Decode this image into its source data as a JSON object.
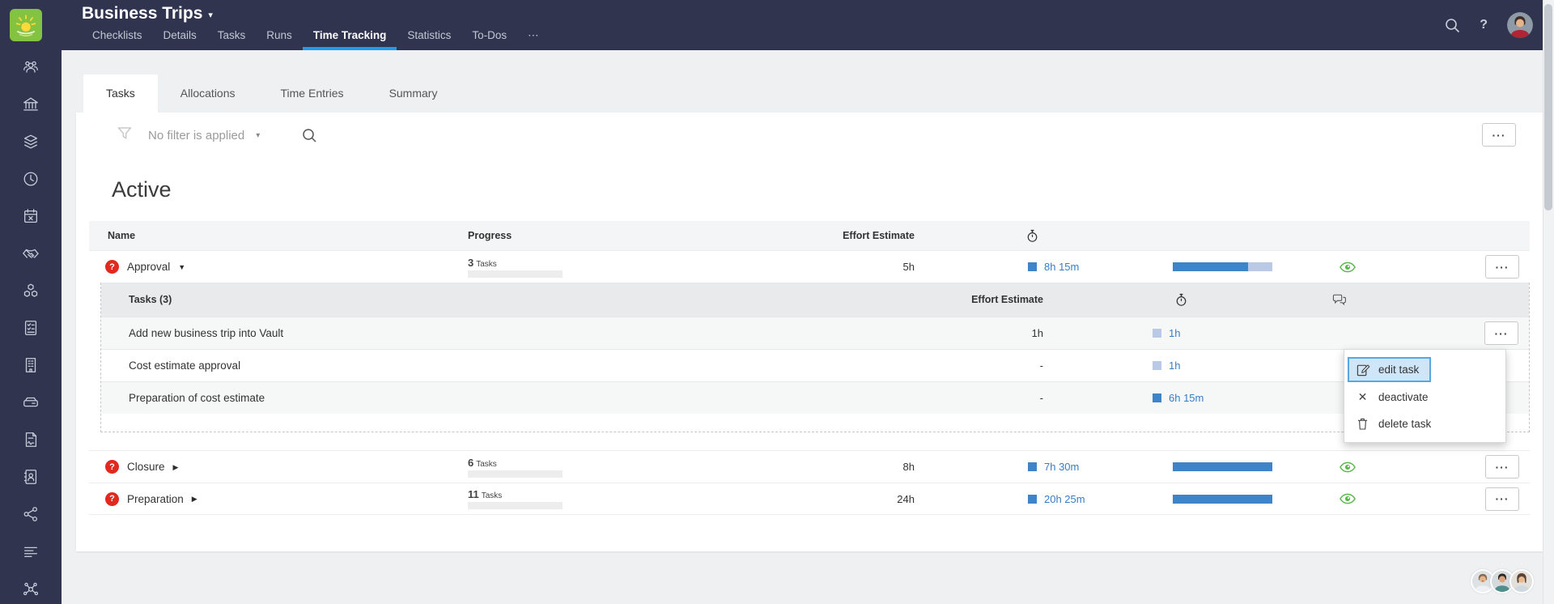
{
  "header": {
    "title": "Business Trips",
    "nav": [
      {
        "label": "Checklists"
      },
      {
        "label": "Details"
      },
      {
        "label": "Tasks"
      },
      {
        "label": "Runs"
      },
      {
        "label": "Time Tracking",
        "active": true
      },
      {
        "label": "Statistics"
      },
      {
        "label": "To-Dos"
      },
      {
        "label": "⋯"
      }
    ],
    "help_glyph": "?"
  },
  "subtabs": [
    {
      "label": "Tasks",
      "active": true
    },
    {
      "label": "Allocations"
    },
    {
      "label": "Time Entries"
    },
    {
      "label": "Summary"
    }
  ],
  "filter": {
    "label": "No filter is applied",
    "caret": "▾"
  },
  "section_title": "Active",
  "table": {
    "headers": {
      "name": "Name",
      "progress": "Progress",
      "effort": "Effort Estimate"
    },
    "rows": [
      {
        "name": "Approval",
        "badge": "?",
        "caret": "▼",
        "tasks_count": "3",
        "tasks_unit": "Tasks",
        "tasks_pct": "0%",
        "effort": "5h",
        "logged": "8h 15m",
        "logged_pct": "76%"
      },
      {
        "name": "Closure",
        "badge": "?",
        "caret": "▶",
        "tasks_count": "6",
        "tasks_unit": "Tasks",
        "tasks_pct": "0%",
        "effort": "8h",
        "logged": "7h 30m",
        "logged_pct": "100%"
      },
      {
        "name": "Preparation",
        "badge": "?",
        "caret": "▶",
        "tasks_count": "11",
        "tasks_unit": "Tasks",
        "tasks_pct": "0%",
        "effort": "24h",
        "logged": "20h 25m",
        "logged_pct": "100%"
      }
    ]
  },
  "subtable": {
    "title": "Tasks (3)",
    "effort_header": "Effort Estimate",
    "rows": [
      {
        "name": "Add new business trip into Vault",
        "effort": "1h",
        "logged": "1h",
        "square": "light"
      },
      {
        "name": "Cost estimate approval",
        "effort": "-",
        "logged": "1h",
        "square": "light"
      },
      {
        "name": "Preparation of cost estimate",
        "effort": "-",
        "logged": "6h 15m",
        "square": "dark"
      }
    ]
  },
  "context_menu": {
    "items": [
      {
        "label": "edit task",
        "highlighted": true
      },
      {
        "label": "deactivate"
      },
      {
        "label": "delete task"
      }
    ]
  },
  "icons": {
    "more": "···",
    "x": "✕"
  },
  "colors": {
    "header_navy": "#30344f",
    "accent_blue": "#1e9bf0",
    "bar_blue": "#3d85c8",
    "bar_blue_light": "#b9c9e6",
    "link_blue": "#3a7cc1",
    "badge_red": "#e12a1f",
    "eye_green": "#5cb84e",
    "logo_green": "#83c341",
    "menu_highlight": "#cfe5f8"
  }
}
